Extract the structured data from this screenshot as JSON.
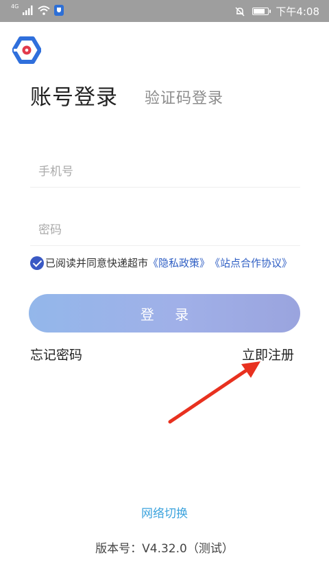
{
  "status_bar": {
    "network_type": "4G",
    "time": "下午4:08",
    "icons": [
      "signal-icon",
      "wifi-icon",
      "shield-app-icon",
      "mute-bell-icon",
      "battery-icon"
    ],
    "battery_level": 0.85
  },
  "tabs": {
    "account_login": "账号登录",
    "code_login": "验证码登录"
  },
  "form": {
    "phone_placeholder": "手机号",
    "password_placeholder": "密码"
  },
  "agreement": {
    "checked": true,
    "prefix": "已阅读并同意快递超市",
    "privacy_link": "《隐私政策》",
    "site_link": "《站点合作协议》"
  },
  "buttons": {
    "login": "登 录",
    "forgot_password": "忘记密码",
    "register": "立即注册"
  },
  "footer": {
    "network_switch": "网络切换",
    "version": "版本号：V4.32.0（测试）"
  },
  "colors": {
    "accent": "#3a59c4",
    "link": "#2f5fc4",
    "button_gradient_start": "#93b7ea",
    "button_gradient_end": "#9aa4de",
    "network_switch": "#3ca3dd",
    "arrow": "#e8311f",
    "logo_blue": "#2f6fdc",
    "logo_red": "#e23a4b"
  }
}
